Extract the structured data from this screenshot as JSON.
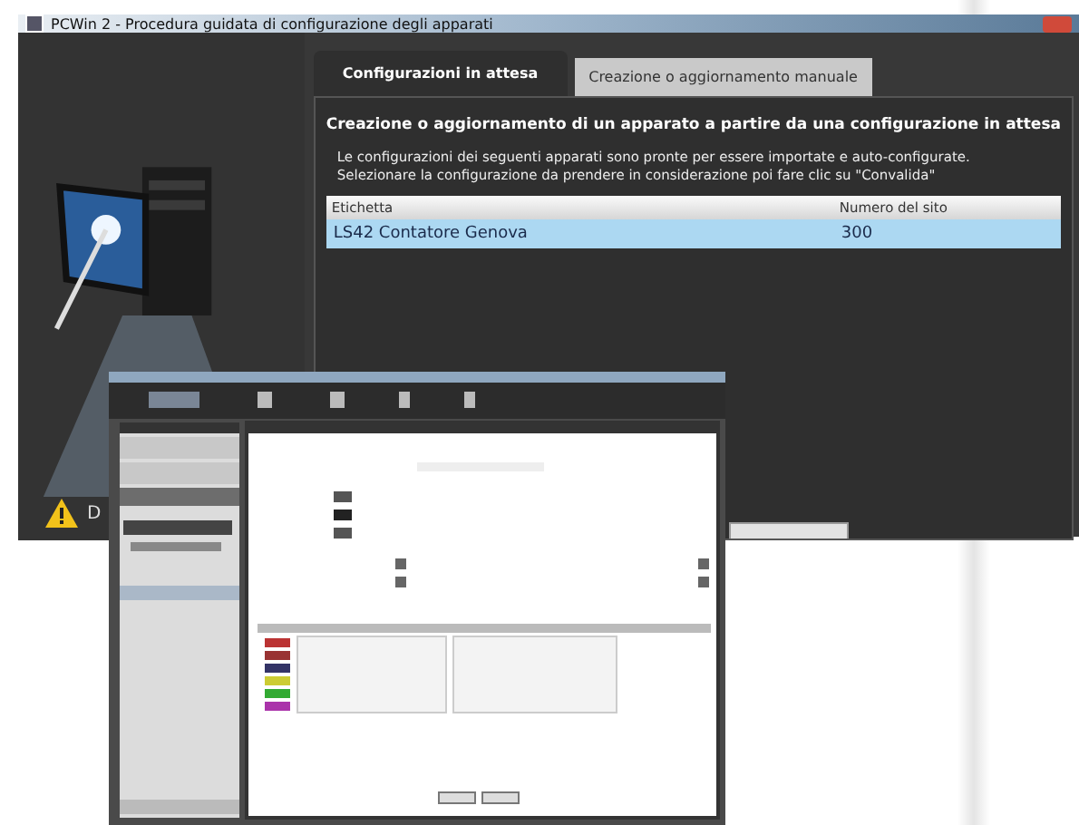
{
  "window": {
    "title": "PCWin 2 - Procedura guidata di configurazione degli apparati"
  },
  "tabs": [
    {
      "label": "Configurazioni in attesa",
      "selected": true
    },
    {
      "label": "Creazione o aggiornamento manuale",
      "selected": false
    }
  ],
  "heading": "Creazione o aggiornamento di un apparato a partire da una configurazione in attesa",
  "description": "Le configurazioni dei seguenti apparati sono pronte per essere importate e auto-configurate. Selezionare la configurazione da prendere in considerazione poi fare clic su \"Convalida\"",
  "table": {
    "columns": [
      "Etichetta",
      "Numero del sito"
    ],
    "rows": [
      {
        "cells": [
          "LS42 Contatore Genova",
          "300"
        ],
        "selected": true
      }
    ]
  },
  "side_text": "D"
}
